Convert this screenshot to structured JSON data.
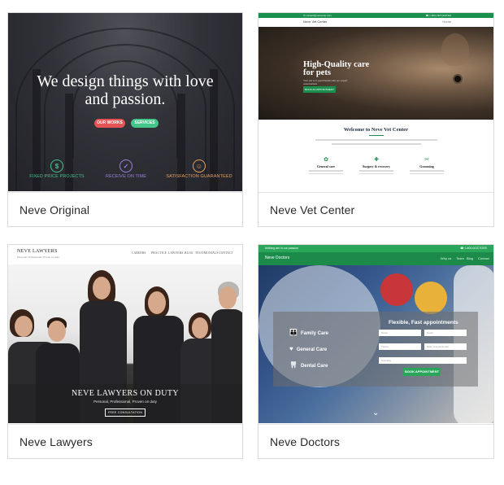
{
  "cards": [
    {
      "title": "Neve Original",
      "hero": {
        "headline_1": "We design things with love",
        "headline_2": "and passion.",
        "button_primary": "OUR WORKS",
        "button_secondary": "SERVICES"
      },
      "features": [
        {
          "label": "FIXED PRICE PROJECTS",
          "icon": "dollar-icon",
          "color": "#45c48b",
          "glyph": "$"
        },
        {
          "label": "RECEIVE ON TIME",
          "icon": "clock-icon",
          "color": "#9b82d8",
          "glyph": "✓"
        },
        {
          "label": "SATISFACTION GUARANTEED",
          "icon": "smile-icon",
          "color": "#e3a35a",
          "glyph": "☺"
        }
      ]
    },
    {
      "title": "Neve Vet Center",
      "topbar": {
        "email": "✉ contact@vetcenter.com",
        "phone": "☎ 1-800-VETCENTER"
      },
      "nav": {
        "brand": "Neve Vet Center",
        "menu": "Home"
      },
      "hero": {
        "headline_1": "High-Quality care",
        "headline_2": "for pets",
        "sub": "Your pet is in good hands with our expert veterinarians",
        "cta": "BOOK AN APPOINTMENT"
      },
      "welcome": "Welcome to Neve Vet Center",
      "services": [
        {
          "title": "General care",
          "icon": "paw-icon",
          "glyph": "✿"
        },
        {
          "title": "Surgery & recovery",
          "icon": "medkit-icon",
          "glyph": "✚"
        },
        {
          "title": "Grooming",
          "icon": "scissors-icon",
          "glyph": "✂"
        }
      ]
    },
    {
      "title": "Neve Lawyers",
      "nav": {
        "brand": "NEVE LAWYERS",
        "tag": "Personal, Professional, Proven on duty",
        "menu": [
          "CAREERS",
          "PRACTICE",
          "LAWYERS",
          "BLOG",
          "TESTIMONIALS",
          "CONTACT"
        ]
      },
      "band": {
        "headline": "NEVE LAWYERS ON DUTY",
        "sub": "Personal, Professional, Proven on duty",
        "button": "FREE CONSULTATION"
      }
    },
    {
      "title": "Neve Doctors",
      "topbar": {
        "left": "Nothing are in our passion",
        "right": "☎ 1-800-DOCTORS"
      },
      "nav": {
        "brand": "Neve Doctors",
        "menu": [
          "Why us",
          "Team",
          "Blog",
          "Contact"
        ]
      },
      "panel": {
        "features": [
          {
            "label": "Family Care",
            "icon": "family-icon",
            "glyph": "👪"
          },
          {
            "label": "General Care",
            "icon": "heart-icon",
            "glyph": "♥"
          },
          {
            "label": "Dental Care",
            "icon": "tooth-icon",
            "glyph": "🦷"
          }
        ],
        "title": "Flexible, Fast appointments",
        "fields": {
          "name": "Name",
          "email": "Email",
          "phone": "Phone",
          "date": "Date of appointment",
          "specialty": "Specialty"
        },
        "button": "BOOK APPOINTMENT"
      },
      "scroll_glyph": "⌄"
    }
  ]
}
